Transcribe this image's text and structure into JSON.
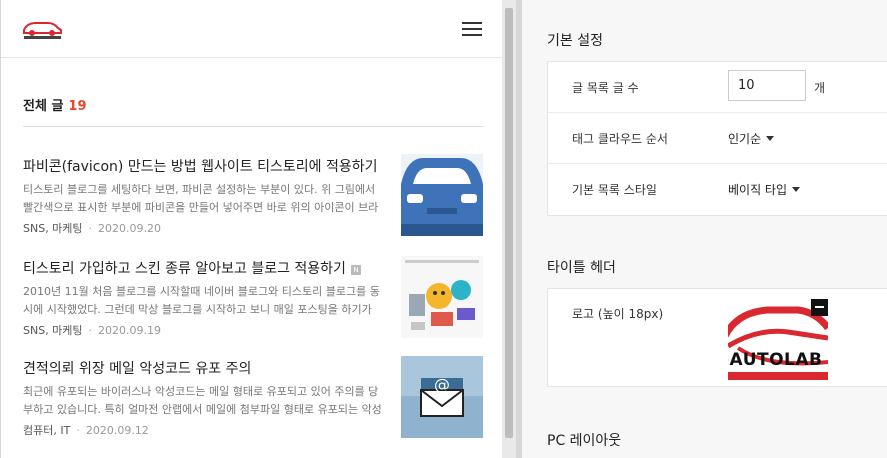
{
  "blog": {
    "logo_alt": "JS AUTOLABO",
    "post_count_label": "전체 글",
    "post_count": "19",
    "posts": [
      {
        "title": "파비콘(favicon) 만드는 방법 웹사이트 티스토리에 적용하기",
        "excerpt": "티스토리 블로그를 세팅하다 보면, 파비콘 설정하는 부분이 있다. 위 그림에서 빨간색으로 표시한 부분에 파비콘을 만들어 넣어주면 바로 위의 아이콘이 브라우저 탭에 표시된다.",
        "category": "SNS, 마케팅",
        "date": "2020.09.20",
        "thumb_icon": "car-icon"
      },
      {
        "title": "티스토리 가입하고 스킨 종류 알아보고 블로그 적용하기",
        "badge": "N",
        "excerpt": "2010년 11월 처음 블로그를 시작할때 네이버 블로그와 티스토리 블로그를 동시에 시작했었다. 그런데 막상 블로그를 시작하고 보니 매일 포스팅을 하기가 쉽지 않았다.",
        "category": "SNS, 마케팅",
        "date": "2020.09.19",
        "thumb_icon": "tistory-skin-icon"
      },
      {
        "title": "견적의뢰 위장 메일 악성코드 유포 주의",
        "excerpt": "최근에 유포되는 바이러스나 악성코드는 메일 형태로 유포되고 있어 주의를 당부하고 있습니다. 특히 얼마전 안랩에서 메일에 첨부파일 형태로 유포되는 악성코드를 발견했다.",
        "category": "컴퓨터, IT",
        "date": "2020.09.12",
        "thumb_icon": "email-icon"
      }
    ]
  },
  "settings": {
    "basic_title": "기본 설정",
    "rows": {
      "post_count_label": "글 목록 글 수",
      "post_count_value": "10",
      "post_count_unit": "개",
      "tag_order_label": "태그 클라우드 순서",
      "tag_order_value": "인기순",
      "list_style_label": "기본 목록 스타일",
      "list_style_value": "베이직 타입"
    },
    "title_header_title": "타이틀 헤더",
    "logo_label": "로고 (높이 18px)",
    "logo_preview_text": "-AUTOLAB",
    "pc_layout_title": "PC 레이아웃"
  },
  "colors": {
    "accent": "#e8472e",
    "logo_red": "#d9282f",
    "car_blue": "#3f73b9"
  }
}
